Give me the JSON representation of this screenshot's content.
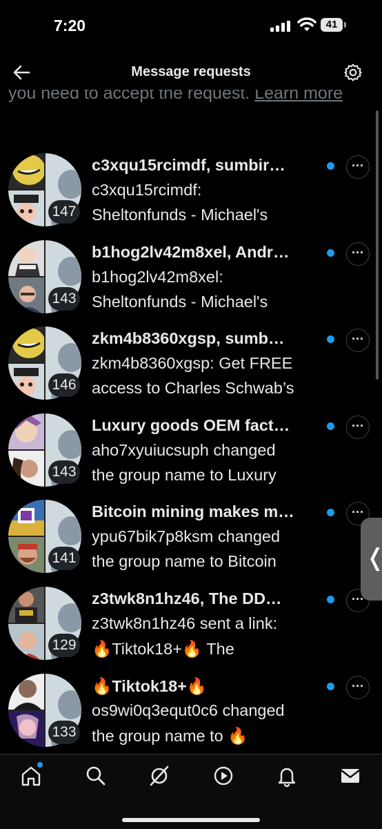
{
  "status": {
    "time": "7:20",
    "battery": "41"
  },
  "header": {
    "title": "Message requests"
  },
  "intro": {
    "text": "you need to accept the request.",
    "link": "Learn more"
  },
  "requests": [
    {
      "name": "c3xqu15rcimdf, sumbir…",
      "line1": "c3xqu15rcimdf:",
      "line2": "Sheltonfunds - Michael's",
      "count": "147",
      "unread": true
    },
    {
      "name": "b1hog2lv42m8xel, Andr…",
      "line1": "b1hog2lv42m8xel:",
      "line2": "Sheltonfunds - Michael's",
      "count": "143",
      "unread": true
    },
    {
      "name": "zkm4b8360xgsp, sumb…",
      "line1": "zkm4b8360xgsp: Get FREE",
      "line2": "access to Charles Schwab’s",
      "count": "146",
      "unread": true
    },
    {
      "name": "Luxury goods OEM fact…",
      "line1": "aho7xyuiucsuph changed",
      "line2": "the group name to Luxury",
      "count": "143",
      "unread": true
    },
    {
      "name": "Bitcoin mining makes m…",
      "line1": "ypu67bik7p8ksm changed",
      "line2": "the group name to Bitcoin",
      "count": "141",
      "unread": true
    },
    {
      "name": "z3twk8n1hz46, The DD…",
      "line1": "z3twk8n1hz46 sent a link:",
      "line2": "🔥Tiktok18+🔥 The",
      "count": "129",
      "unread": true
    },
    {
      "name": "🔥Tiktok18+🔥",
      "line1": "os9wi0q3equt0c6 changed",
      "line2": "the group name to 🔥",
      "count": "133",
      "unread": true
    }
  ],
  "more_glyph": "···",
  "side_handle_glyph": "❬",
  "tabs": [
    "home-icon",
    "search-icon",
    "grok-icon",
    "video-icon",
    "notifications-icon",
    "messages-icon"
  ],
  "colors": {
    "accent": "#1d9bf0",
    "background": "#000000",
    "muted": "#71767b"
  }
}
